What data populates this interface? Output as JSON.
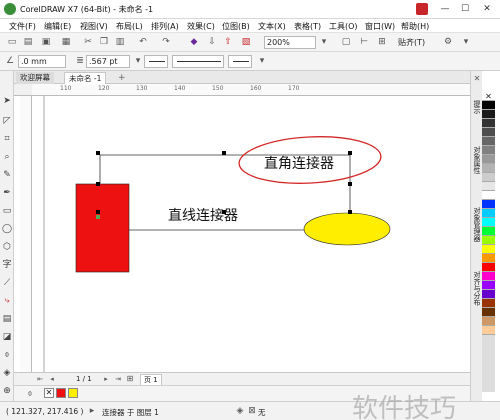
{
  "window": {
    "title": "CorelDRAW X7 (64-Bit) - 未命名 -1",
    "minimize": "—",
    "maximize": "☐",
    "close": "✕"
  },
  "menu": [
    "文件(F)",
    "编辑(E)",
    "视图(V)",
    "布局(L)",
    "排列(A)",
    "效果(C)",
    "位图(B)",
    "文本(X)",
    "表格(T)",
    "工具(O)",
    "窗口(W)",
    "帮助(H)"
  ],
  "toolbar": {
    "zoom": "200%",
    "snap": "贴齐(T)"
  },
  "propbar": {
    "x_value": ".0 mm",
    "outline_width": ".567 pt"
  },
  "tabs": [
    "欢迎屏幕",
    "未命名 -1"
  ],
  "ruler": {
    "h_labels": [
      "110",
      "120",
      "130",
      "140",
      "150",
      "160",
      "170"
    ]
  },
  "canvas": {
    "label_straight": "直线连接器",
    "label_right_angle": "直角连接器"
  },
  "dockers": [
    "提示",
    "对象属性",
    "对象管理器",
    "对齐与分布"
  ],
  "pagebar": {
    "counter": "1 / 1",
    "page_tab": "页 1"
  },
  "status": {
    "coords": "( 121.327, 217.416 )",
    "selection": "连接器 于 图层 1",
    "fill_none": "无"
  },
  "watermark": "软件技巧",
  "colors": {
    "rect_fill": "#ee1111",
    "ellipse_fill": "#ffee00",
    "annotation": "#d42828",
    "accent": "#c8262a"
  }
}
